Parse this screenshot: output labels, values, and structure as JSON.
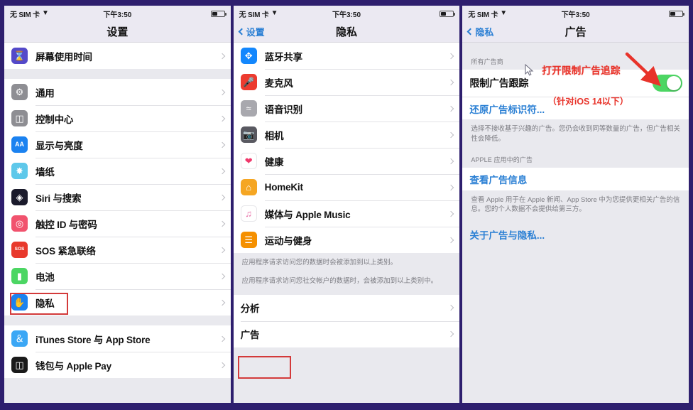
{
  "status_bar": {
    "carrier": "无 SIM 卡",
    "wifi_icon": "wifi-icon",
    "time": "下午3:50",
    "battery_icon": "battery-icon"
  },
  "panel_settings": {
    "nav_title": "设置",
    "groups": [
      {
        "rows": [
          {
            "icon": "screen-time-icon",
            "label": "屏幕使用时间"
          }
        ]
      },
      {
        "rows": [
          {
            "icon": "general-icon",
            "label": "通用"
          },
          {
            "icon": "control-center-icon",
            "label": "控制中心"
          },
          {
            "icon": "display-brightness-icon",
            "label": "显示与亮度"
          },
          {
            "icon": "wallpaper-icon",
            "label": "墙纸"
          },
          {
            "icon": "siri-search-icon",
            "label": "Siri 与搜索"
          },
          {
            "icon": "touch-id-icon",
            "label": "触控 ID 与密码"
          },
          {
            "icon": "sos-icon",
            "label": "SOS 紧急联络"
          },
          {
            "icon": "battery-icon",
            "label": "电池"
          },
          {
            "icon": "privacy-icon",
            "label": "隐私"
          }
        ]
      },
      {
        "rows": [
          {
            "icon": "itunes-appstore-icon",
            "label": "iTunes Store 与 App Store"
          },
          {
            "icon": "wallet-applepay-icon",
            "label": "钱包与 Apple Pay"
          }
        ]
      }
    ],
    "highlight_row_label": "隐私"
  },
  "panel_privacy": {
    "nav_back": "设置",
    "nav_title": "隐私",
    "rows": [
      {
        "icon": "bluetooth-icon",
        "label": "蓝牙共享"
      },
      {
        "icon": "microphone-icon",
        "label": "麦克风"
      },
      {
        "icon": "speech-recognition-icon",
        "label": "语音识别"
      },
      {
        "icon": "camera-icon",
        "label": "相机"
      },
      {
        "icon": "health-icon",
        "label": "健康"
      },
      {
        "icon": "homekit-icon",
        "label": "HomeKit"
      },
      {
        "icon": "apple-music-icon",
        "label": "媒体与 Apple Music"
      },
      {
        "icon": "fitness-icon",
        "label": "运动与健身"
      }
    ],
    "footer_1": "应用程序请求访问您的数据时会被添加到以上类别。",
    "footer_2": "应用程序请求访问您社交帐户的数据时，会被添加到以上类别中。",
    "bottom_rows": [
      {
        "label": "分析"
      },
      {
        "label": "广告"
      }
    ],
    "highlight_row_label": "广告"
  },
  "panel_ads": {
    "nav_back": "隐私",
    "nav_title": "广告",
    "section_header": "所有广告商",
    "toggle_label": "限制广告跟踪",
    "toggle_on": true,
    "reset_link": "还原广告标识符...",
    "footer_1": "选择不接收基于兴趣的广告。您仍会收到同等数量的广告，但广告相关性会降低。",
    "section_header_2": "APPLE 应用中的广告",
    "view_ads_link": "查看广告信息",
    "footer_2": "查看 Apple 用于在 Apple 新闻、App Store 中为您提供更相关广告的信息。您的个人数据不会提供给第三方。",
    "about_link": "关于广告与隐私..."
  },
  "annotations": {
    "instruction": "打开限制广告追踪",
    "note": "（针对iOS 14以下）",
    "arrow_icon": "red-arrow-icon",
    "cursor_icon": "mouse-cursor-icon",
    "highlight_color": "#d33a3a",
    "annotation_color": "#e8332a"
  }
}
